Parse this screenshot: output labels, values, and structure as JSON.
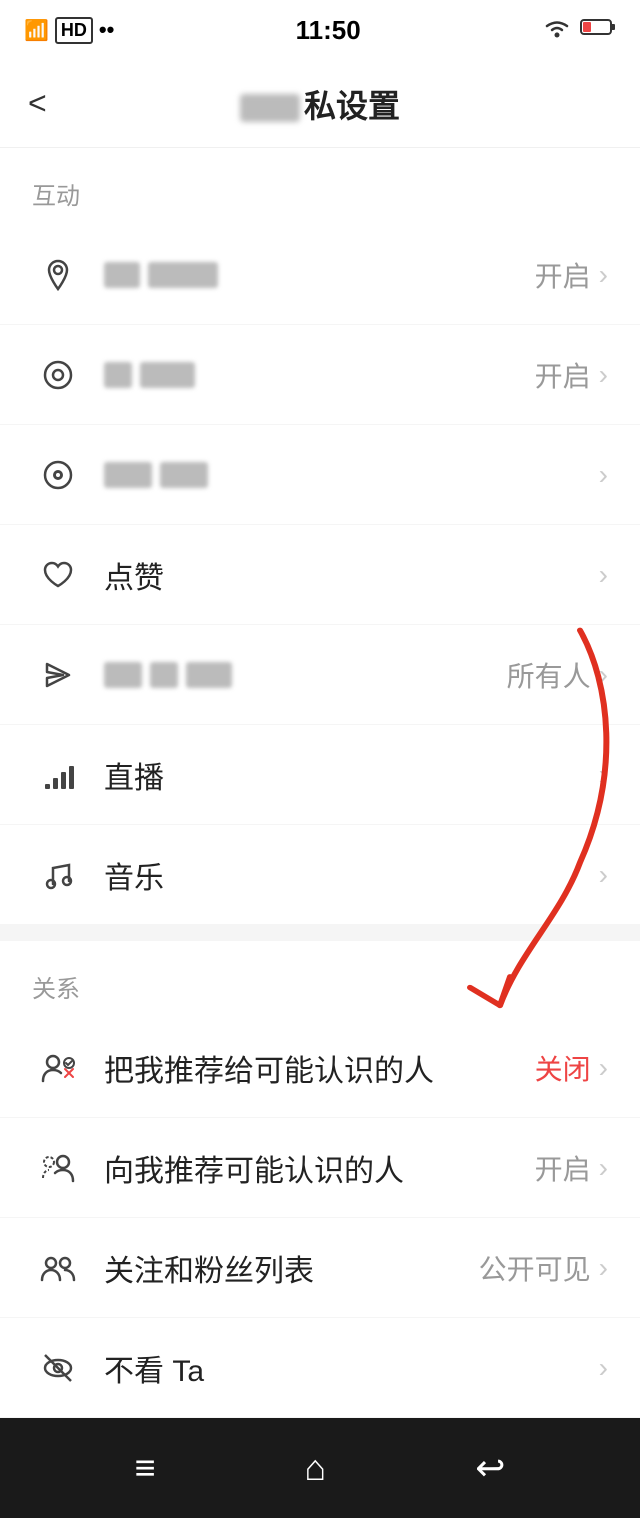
{
  "statusBar": {
    "time": "11:50",
    "signal": "4G HD",
    "wifi": "WiFi",
    "battery": "low"
  },
  "header": {
    "back": "<",
    "title": "隐私设置"
  },
  "sections": [
    {
      "label": "互动",
      "items": [
        {
          "icon": "📍",
          "iconName": "location-icon",
          "textBlurred": true,
          "textParts": [
            40,
            80
          ],
          "value": "开启",
          "chevron": ">"
        },
        {
          "icon": "◎",
          "iconName": "online-icon",
          "textBlurred": true,
          "textParts": [
            30,
            60
          ],
          "value": "开启",
          "chevron": ">"
        },
        {
          "icon": "👁",
          "iconName": "view-icon",
          "textBlurred": true,
          "textParts": [
            50,
            50
          ],
          "value": "",
          "chevron": ">"
        },
        {
          "icon": "♡",
          "iconName": "like-icon",
          "text": "点赞",
          "textBlurred": false,
          "value": "",
          "chevron": ">"
        },
        {
          "icon": "✈",
          "iconName": "send-icon",
          "textBlurred": true,
          "textParts": [
            40,
            30,
            50
          ],
          "value": "所有人",
          "chevron": ">"
        },
        {
          "icon": "📊",
          "iconName": "live-icon",
          "text": "直播",
          "textBlurred": false,
          "value": "",
          "chevron": ">"
        },
        {
          "icon": "♪",
          "iconName": "music-icon",
          "text": "音乐",
          "textBlurred": false,
          "value": "",
          "chevron": ">"
        }
      ]
    },
    {
      "label": "关系",
      "items": [
        {
          "icon": "👤",
          "iconName": "recommend-to-icon",
          "text": "把我推荐给可能认识的人",
          "textBlurred": false,
          "value": "关闭",
          "chevron": ">"
        },
        {
          "icon": "👥",
          "iconName": "recommend-from-icon",
          "text": "向我推荐可能认识的人",
          "textBlurred": false,
          "value": "开启",
          "chevron": ">"
        },
        {
          "icon": "👫",
          "iconName": "follow-list-icon",
          "text": "关注和粉丝列表",
          "textBlurred": false,
          "value": "公开可见",
          "chevron": ">"
        },
        {
          "icon": "🚫",
          "iconName": "not-see-icon",
          "text": "不看 Ta",
          "textBlurred": false,
          "value": "",
          "chevron": ">"
        }
      ]
    }
  ],
  "bottomNav": {
    "menu": "≡",
    "home": "⌂",
    "back": "↩"
  }
}
